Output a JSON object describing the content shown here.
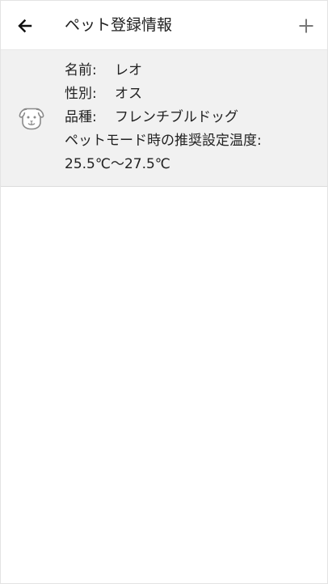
{
  "header": {
    "title": "ペット登録情報",
    "back_icon": "arrow-left-icon",
    "add_icon": "plus-icon"
  },
  "pet": {
    "icon": "dog-icon",
    "name_label": "名前:",
    "name_value": "レオ",
    "sex_label": "性別:",
    "sex_value": "オス",
    "breed_label": "品種:",
    "breed_value": "フレンチブルドッグ",
    "temperature_label": "ペットモード時の推奨設定温度:",
    "temperature_value": "25.5℃〜27.5℃"
  },
  "colors": {
    "card_background": "#f1f1f1",
    "text": "#222222",
    "icon": "#8a8a8a",
    "border": "#dcdcdc"
  }
}
